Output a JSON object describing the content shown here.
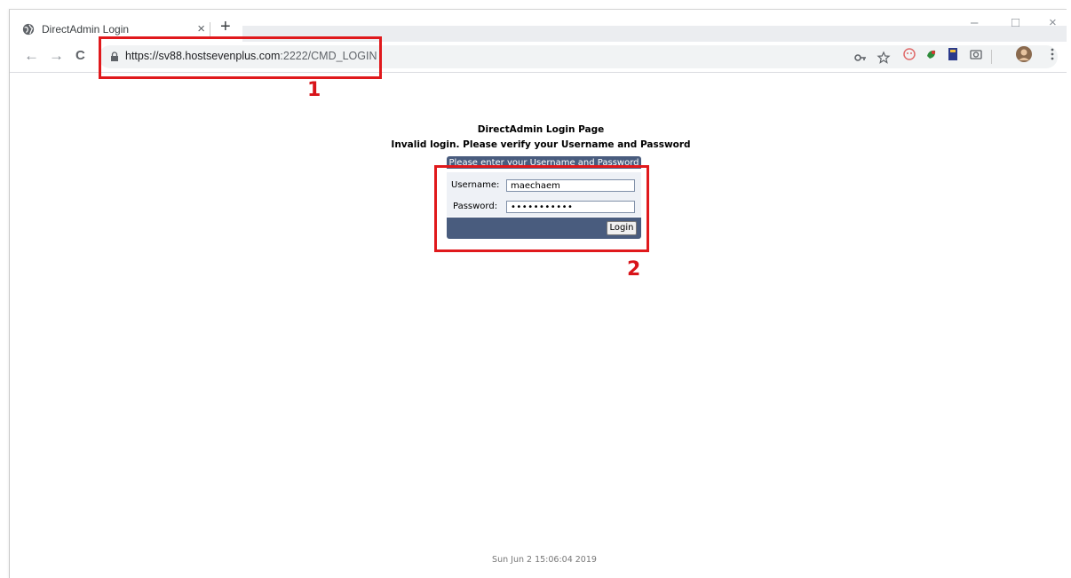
{
  "browser": {
    "tab_title": "DirectAdmin Login",
    "tab_close": "×",
    "new_tab": "+",
    "url_host": "https://sv88.hostsevenplus.com",
    "url_path": ":2222/CMD_LOGIN",
    "nav": {
      "back": "←",
      "forward": "→",
      "reload": "C"
    },
    "window_controls": {
      "minimize": "–",
      "maximize": "□",
      "close": "×"
    }
  },
  "annotations": {
    "marker_1": "1",
    "marker_2": "2"
  },
  "page": {
    "title": "DirectAdmin Login Page",
    "error_message": "Invalid login. Please verify your Username and Password",
    "form_header": "Please enter your Username and Password",
    "username_label": "Username:",
    "username_value": "maechaem",
    "password_label": "Password:",
    "password_value": "•••••••••••",
    "login_button": "Login",
    "timestamp": "Sun Jun 2 15:06:04 2019"
  },
  "colors": {
    "form_header_bg": "#495c7e",
    "annotation_red": "#e0191c"
  },
  "icons": [
    "globe-icon",
    "lock-icon",
    "key-icon",
    "star-icon",
    "extension-icon",
    "profile-avatar-icon",
    "menu-icon"
  ]
}
